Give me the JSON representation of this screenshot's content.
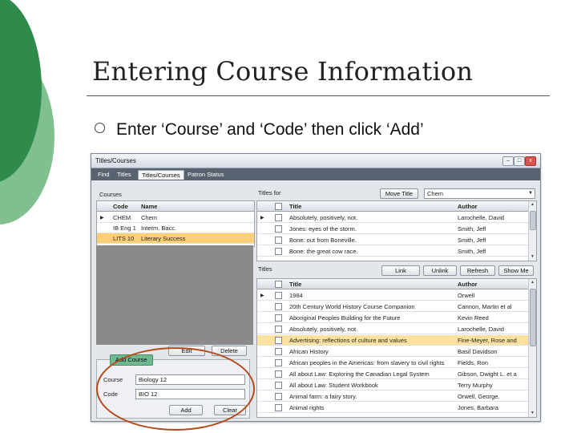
{
  "slide": {
    "title": "Entering Course Information",
    "bullet": "Enter ‘Course’ and ‘Code’ then click ‘Add’"
  },
  "colors": {
    "deco_dark": "#2e8b4b",
    "deco_light": "#7fc08e",
    "annotation": "#b54a1a",
    "selection": "#ffcf76"
  },
  "window": {
    "title": "Titles/Courses",
    "controls": {
      "minimize": "–",
      "maximize": "□",
      "close": "x"
    },
    "menu": [
      "Find",
      "Titles",
      "Titles/Courses",
      "Patron Status"
    ],
    "active_menu": "Titles/Courses"
  },
  "courses": {
    "label": "Courses",
    "columns": [
      "Code",
      "Name"
    ],
    "rows": [
      {
        "code": "CHEM",
        "name": "Chem"
      },
      {
        "code": "IB Eng 1",
        "name": "Interm. Bacc."
      },
      {
        "code": "LITS 10",
        "name": "Literary Success"
      }
    ],
    "edit_label": "Edit",
    "delete_label": "Delete"
  },
  "titles_for": {
    "label": "Titles for",
    "move_label": "Move Title",
    "selected_course": "Chem",
    "columns": [
      "Title",
      "Author"
    ],
    "rows": [
      {
        "title": "Absolutely, positively, not.",
        "author": "Larochelle, David"
      },
      {
        "title": "Jones: eyes of the storm.",
        "author": "Smith, Jeff"
      },
      {
        "title": "Bone: out from Boneville.",
        "author": "Smith, Jeff"
      },
      {
        "title": "Bone: the great cow race.",
        "author": "Smith, Jeff"
      }
    ]
  },
  "titles": {
    "label": "Titles",
    "buttons": [
      "Link",
      "Unlink",
      "Refresh",
      "Show Me"
    ],
    "columns": [
      "Title",
      "Author"
    ],
    "rows": [
      {
        "title": "1984",
        "author": "Orwell"
      },
      {
        "title": "20th Century World History Course Companion",
        "author": "Cannon, Martin et al"
      },
      {
        "title": "Aboriginal Peoples Building for the Future",
        "author": "Kevin Reed"
      },
      {
        "title": "Absolutely, positively, not.",
        "author": "Larochelle, David"
      },
      {
        "title": "Advertising: reflections of culture and values",
        "author": "Fine-Meyer, Rose and"
      },
      {
        "title": "African History",
        "author": "Basil Davidson"
      },
      {
        "title": "African peoples in the Americas: from slavery to civil rights",
        "author": "Fields, Ron"
      },
      {
        "title": "All about Law: Exploring the Canadian Legal System",
        "author": "Gibson, Dwight L. et a"
      },
      {
        "title": "All about Law: Student Workbook",
        "author": "Terry Murphy"
      },
      {
        "title": "Animal farm: a fairy story.",
        "author": "Orwell, George."
      },
      {
        "title": "Animal rights",
        "author": "Jones, Barbara"
      }
    ]
  },
  "add_course": {
    "tab": "Add Course",
    "course_label": "Course",
    "course_value": "Biology 12",
    "code_label": "Code",
    "code_value": "BIO 12",
    "add_label": "Add",
    "clear_label": "Clear"
  }
}
